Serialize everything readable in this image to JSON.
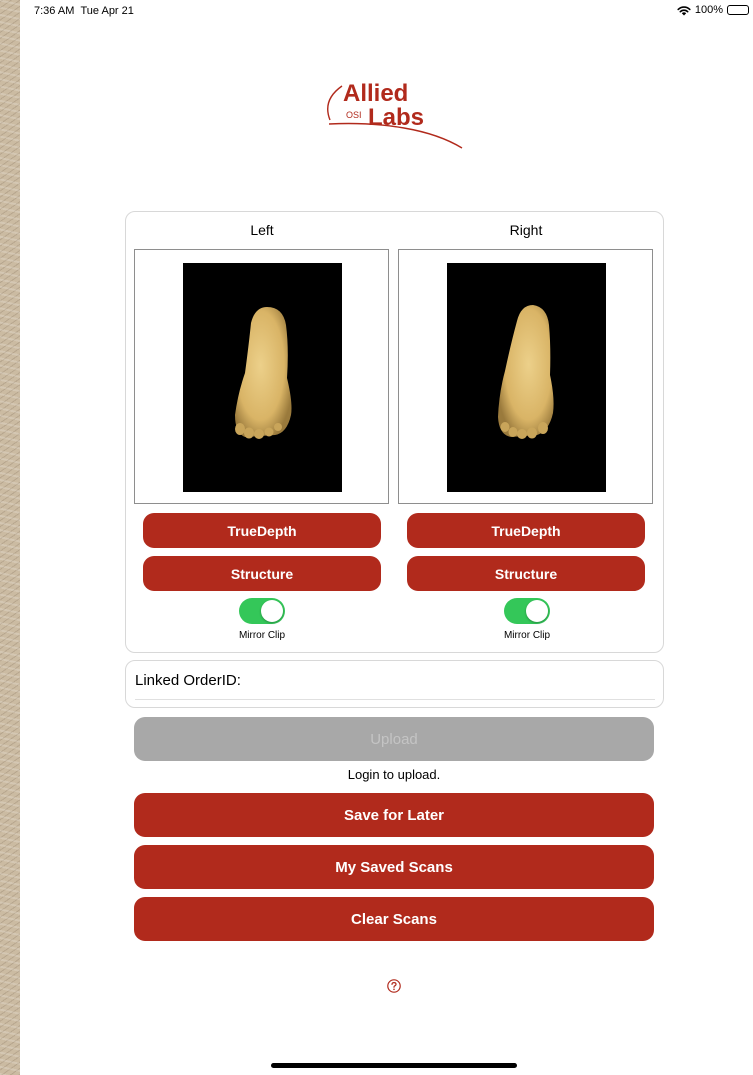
{
  "status_bar": {
    "time": "7:36 AM",
    "date": "Tue Apr 21",
    "battery": "100%",
    "icons": [
      "wifi-icon",
      "battery-icon"
    ]
  },
  "logo": {
    "line1": "Allied",
    "line2": "Labs",
    "mark": "OSI",
    "color": "#b12a1c"
  },
  "scan": {
    "left": {
      "label": "Left",
      "truedepth_label": "TrueDepth",
      "structure_label": "Structure",
      "mirror_label": "Mirror Clip",
      "mirror_on": true
    },
    "right": {
      "label": "Right",
      "truedepth_label": "TrueDepth",
      "structure_label": "Structure",
      "mirror_label": "Mirror Clip",
      "mirror_on": true
    }
  },
  "order": {
    "label": "Linked OrderID:",
    "value": ""
  },
  "actions": {
    "upload_label": "Upload",
    "login_hint": "Login to upload.",
    "save_later_label": "Save for Later",
    "saved_scans_label": "My Saved Scans",
    "clear_label": "Clear Scans"
  },
  "colors": {
    "accent": "#b12a1c",
    "toggle_on": "#34c759",
    "disabled": "#a8a8a8"
  },
  "help_icon": "question-circle-icon"
}
